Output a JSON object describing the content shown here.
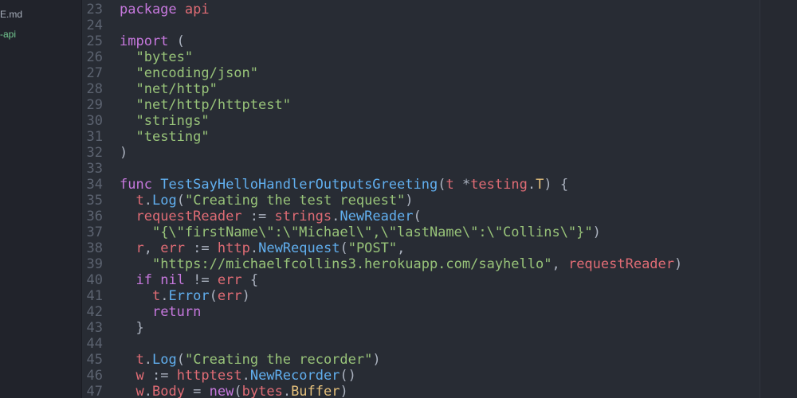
{
  "sidebar": {
    "files": [
      {
        "label": "E.md",
        "active": false
      },
      {
        "label": "-api",
        "active": true
      }
    ]
  },
  "colors": {
    "background": "#282c34",
    "line_number": "#5c6370",
    "keyword": "#c678dd",
    "identifier": "#e06c75",
    "string": "#98c379",
    "function": "#61afef",
    "type": "#e5c07b",
    "plain": "#abb2bf",
    "sidebar_active": "#73c991"
  },
  "editor": {
    "lines": [
      {
        "num": "23",
        "tokens": [
          {
            "t": "package",
            "c": "kw"
          },
          {
            "t": " ",
            "c": "pun"
          },
          {
            "t": "api",
            "c": "id"
          }
        ]
      },
      {
        "num": "24",
        "tokens": []
      },
      {
        "num": "25",
        "tokens": [
          {
            "t": "import",
            "c": "kw"
          },
          {
            "t": " (",
            "c": "pun"
          }
        ]
      },
      {
        "num": "26",
        "tokens": [
          {
            "t": "  ",
            "c": "pun"
          },
          {
            "t": "\"bytes\"",
            "c": "str"
          }
        ]
      },
      {
        "num": "27",
        "tokens": [
          {
            "t": "  ",
            "c": "pun"
          },
          {
            "t": "\"encoding/json\"",
            "c": "str"
          }
        ]
      },
      {
        "num": "28",
        "tokens": [
          {
            "t": "  ",
            "c": "pun"
          },
          {
            "t": "\"net/http\"",
            "c": "str"
          }
        ]
      },
      {
        "num": "29",
        "tokens": [
          {
            "t": "  ",
            "c": "pun"
          },
          {
            "t": "\"net/http/httptest\"",
            "c": "str"
          }
        ]
      },
      {
        "num": "30",
        "tokens": [
          {
            "t": "  ",
            "c": "pun"
          },
          {
            "t": "\"strings\"",
            "c": "str"
          }
        ]
      },
      {
        "num": "31",
        "tokens": [
          {
            "t": "  ",
            "c": "pun"
          },
          {
            "t": "\"testing\"",
            "c": "str"
          }
        ]
      },
      {
        "num": "32",
        "tokens": [
          {
            "t": ")",
            "c": "pun"
          }
        ]
      },
      {
        "num": "33",
        "tokens": []
      },
      {
        "num": "34",
        "tokens": [
          {
            "t": "func",
            "c": "kw"
          },
          {
            "t": " ",
            "c": "pun"
          },
          {
            "t": "TestSayHelloHandlerOutputsGreeting",
            "c": "fn"
          },
          {
            "t": "(",
            "c": "pun"
          },
          {
            "t": "t",
            "c": "id"
          },
          {
            "t": " *",
            "c": "pun"
          },
          {
            "t": "testing",
            "c": "id"
          },
          {
            "t": ".",
            "c": "pun"
          },
          {
            "t": "T",
            "c": "ty"
          },
          {
            "t": ") {",
            "c": "pun"
          }
        ]
      },
      {
        "num": "35",
        "tokens": [
          {
            "t": "  ",
            "c": "pun"
          },
          {
            "t": "t",
            "c": "id"
          },
          {
            "t": ".",
            "c": "pun"
          },
          {
            "t": "Log",
            "c": "fn"
          },
          {
            "t": "(",
            "c": "pun"
          },
          {
            "t": "\"Creating the test request\"",
            "c": "str"
          },
          {
            "t": ")",
            "c": "pun"
          }
        ]
      },
      {
        "num": "36",
        "tokens": [
          {
            "t": "  ",
            "c": "pun"
          },
          {
            "t": "requestReader",
            "c": "id"
          },
          {
            "t": " := ",
            "c": "pun"
          },
          {
            "t": "strings",
            "c": "id"
          },
          {
            "t": ".",
            "c": "pun"
          },
          {
            "t": "NewReader",
            "c": "fn"
          },
          {
            "t": "(",
            "c": "pun"
          }
        ]
      },
      {
        "num": "37",
        "tokens": [
          {
            "t": "    ",
            "c": "pun"
          },
          {
            "t": "\"{\\\"firstName\\\":\\\"Michael\\\",\\\"lastName\\\":\\\"Collins\\\"}\"",
            "c": "str"
          },
          {
            "t": ")",
            "c": "pun"
          }
        ]
      },
      {
        "num": "38",
        "tokens": [
          {
            "t": "  ",
            "c": "pun"
          },
          {
            "t": "r",
            "c": "id"
          },
          {
            "t": ", ",
            "c": "pun"
          },
          {
            "t": "err",
            "c": "id"
          },
          {
            "t": " := ",
            "c": "pun"
          },
          {
            "t": "http",
            "c": "id"
          },
          {
            "t": ".",
            "c": "pun"
          },
          {
            "t": "NewRequest",
            "c": "fn"
          },
          {
            "t": "(",
            "c": "pun"
          },
          {
            "t": "\"POST\"",
            "c": "str"
          },
          {
            "t": ",",
            "c": "pun"
          }
        ]
      },
      {
        "num": "39",
        "tokens": [
          {
            "t": "    ",
            "c": "pun"
          },
          {
            "t": "\"https://michaelfcollins3.herokuapp.com/sayhello\"",
            "c": "str"
          },
          {
            "t": ", ",
            "c": "pun"
          },
          {
            "t": "requestReader",
            "c": "id"
          },
          {
            "t": ")",
            "c": "pun"
          }
        ]
      },
      {
        "num": "40",
        "tokens": [
          {
            "t": "  ",
            "c": "pun"
          },
          {
            "t": "if",
            "c": "kw"
          },
          {
            "t": " ",
            "c": "pun"
          },
          {
            "t": "nil",
            "c": "kw"
          },
          {
            "t": " != ",
            "c": "pun"
          },
          {
            "t": "err",
            "c": "id"
          },
          {
            "t": " {",
            "c": "pun"
          }
        ]
      },
      {
        "num": "41",
        "tokens": [
          {
            "t": "    ",
            "c": "pun"
          },
          {
            "t": "t",
            "c": "id"
          },
          {
            "t": ".",
            "c": "pun"
          },
          {
            "t": "Error",
            "c": "fn"
          },
          {
            "t": "(",
            "c": "pun"
          },
          {
            "t": "err",
            "c": "id"
          },
          {
            "t": ")",
            "c": "pun"
          }
        ]
      },
      {
        "num": "42",
        "tokens": [
          {
            "t": "    ",
            "c": "pun"
          },
          {
            "t": "return",
            "c": "kw"
          }
        ]
      },
      {
        "num": "43",
        "tokens": [
          {
            "t": "  }",
            "c": "pun"
          }
        ]
      },
      {
        "num": "44",
        "tokens": []
      },
      {
        "num": "45",
        "tokens": [
          {
            "t": "  ",
            "c": "pun"
          },
          {
            "t": "t",
            "c": "id"
          },
          {
            "t": ".",
            "c": "pun"
          },
          {
            "t": "Log",
            "c": "fn"
          },
          {
            "t": "(",
            "c": "pun"
          },
          {
            "t": "\"Creating the recorder\"",
            "c": "str"
          },
          {
            "t": ")",
            "c": "pun"
          }
        ]
      },
      {
        "num": "46",
        "tokens": [
          {
            "t": "  ",
            "c": "pun"
          },
          {
            "t": "w",
            "c": "id"
          },
          {
            "t": " := ",
            "c": "pun"
          },
          {
            "t": "httptest",
            "c": "id"
          },
          {
            "t": ".",
            "c": "pun"
          },
          {
            "t": "NewRecorder",
            "c": "fn"
          },
          {
            "t": "()",
            "c": "pun"
          }
        ]
      },
      {
        "num": "47",
        "tokens": [
          {
            "t": "  ",
            "c": "pun"
          },
          {
            "t": "w",
            "c": "id"
          },
          {
            "t": ".",
            "c": "pun"
          },
          {
            "t": "Body",
            "c": "id"
          },
          {
            "t": " = ",
            "c": "pun"
          },
          {
            "t": "new",
            "c": "kw"
          },
          {
            "t": "(",
            "c": "pun"
          },
          {
            "t": "bytes",
            "c": "id"
          },
          {
            "t": ".",
            "c": "pun"
          },
          {
            "t": "Buffer",
            "c": "ty"
          },
          {
            "t": ")",
            "c": "pun"
          }
        ]
      }
    ]
  }
}
